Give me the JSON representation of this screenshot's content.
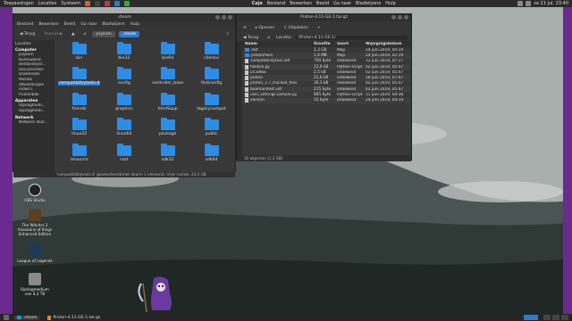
{
  "top_panel": {
    "menus": [
      "Toepassingen",
      "Locaties",
      "Systeem"
    ],
    "center": [
      "Caja",
      "Bestand",
      "Bewerken",
      "Beeld",
      "Ga naar",
      "Bladwijzers",
      "Hulp"
    ],
    "clock": "za 21 jul, 23:40"
  },
  "left_window": {
    "title": ".steam",
    "menu": [
      "Bestand",
      "Bewerken",
      "Beeld",
      "Ga naar",
      "Bladwijzers",
      "Hulp"
    ],
    "back": "Terug",
    "forward": "Vooruit",
    "locations_label": "Locaties",
    "breadcrumbs": [
      "psykom",
      ".steam"
    ],
    "sidebar": {
      "computer_header": "Computer",
      "computer_items": [
        "psykom",
        "Bureaublad",
        "Bestandsyst...",
        "Documenten",
        "Downloads",
        "Muziek",
        "Afbeeldingen",
        "Video's",
        "Prullenbak"
      ],
      "devices_header": "Apparaten",
      "devices_items": [
        "Opslagmedi...",
        "Opslagmedi..."
      ],
      "network_header": "Netwerk",
      "network_items": [
        "Netwerk door..."
      ]
    },
    "folders": [
      "bin",
      "bin32",
      "bin64",
      "clientui",
      "compatibilitytools.d",
      "config",
      "controller_base",
      "fontconfig",
      "friends",
      "graphics",
      "htmlSapp",
      "legacycompat",
      "linux32",
      "linux64",
      "package",
      "public",
      "resource",
      "root",
      "sdk32",
      "sdk64"
    ],
    "selected_folder": "compatibilitytools.d",
    "status": "'compatibilitytools.d' geselecteerd(met daarin 1 element), Vrije ruimte: 24,2 GB"
  },
  "right_window": {
    "title": "Proton-4.11-GE-1.tar.gz",
    "back": "Terug",
    "open_label": "Openen",
    "extract_label": "Uitpakken",
    "location_label": "Locatie:",
    "location_value": "/Proton-4.11-GE-1/",
    "columns": [
      "Naam",
      "Grootte",
      "Soort",
      "Wijzigingsdatum"
    ],
    "rows": [
      {
        "name": "dist",
        "size": "1,3 GB",
        "type": "Map",
        "date": "24 juni 2019, 04:19",
        "kind": "folder"
      },
      {
        "name": "protonfixes",
        "size": "1,4 MB",
        "type": "Map",
        "date": "24 juni 2019, 02:19",
        "kind": "folder"
      },
      {
        "name": "compatibilitytool.vdf",
        "size": "700 byte",
        "type": "onbekend",
        "date": "12 juni 2019, 07:17",
        "kind": "file"
      },
      {
        "name": "filelock.py",
        "size": "12,6 kB",
        "type": "Python-script",
        "date": "02 juni 2019, 05:47",
        "kind": "file"
      },
      {
        "name": "LICENSE",
        "size": "2,5 kB",
        "type": "onbekend",
        "date": "02 juni 2019, 05:47",
        "kind": "file"
      },
      {
        "name": "proton",
        "size": "22,6 kB",
        "type": "onbekend",
        "date": "18 juni 2019, 07:47",
        "kind": "file"
      },
      {
        "name": "proton_3.7_tracked_files",
        "size": "36,3 kB",
        "type": "onbekend",
        "date": "02 juni 2019, 05:47",
        "kind": "file"
      },
      {
        "name": "toolmanifest.vdf",
        "size": "215 byte",
        "type": "onbekend",
        "date": "02 juni 2019, 05:47",
        "kind": "file"
      },
      {
        "name": "user_settings.sample.py",
        "size": "885 byte",
        "type": "Python-script",
        "date": "11 juni 2019, 04:38",
        "kind": "file"
      },
      {
        "name": "version",
        "size": "33 byte",
        "type": "onbekend",
        "date": "24 juni 2019, 04:19",
        "kind": "file"
      }
    ],
    "status": "10 objecten (1,3 GB)"
  },
  "desktop_icons": [
    {
      "label": "OBS Studio",
      "color": "#222222"
    },
    {
      "label": "The Witcher 2 Assassins of Kings Enhanced Edition",
      "color": "#5a4020"
    },
    {
      "label": "League of Legends",
      "color": "#1d3a5a"
    },
    {
      "label": "Opslagmedium van 4,3 TB",
      "color": "#8a8a8a"
    }
  ],
  "taskbar": {
    "tasks": [
      ".steam",
      "Proton-4.11-GE-1.tar.gz"
    ]
  }
}
